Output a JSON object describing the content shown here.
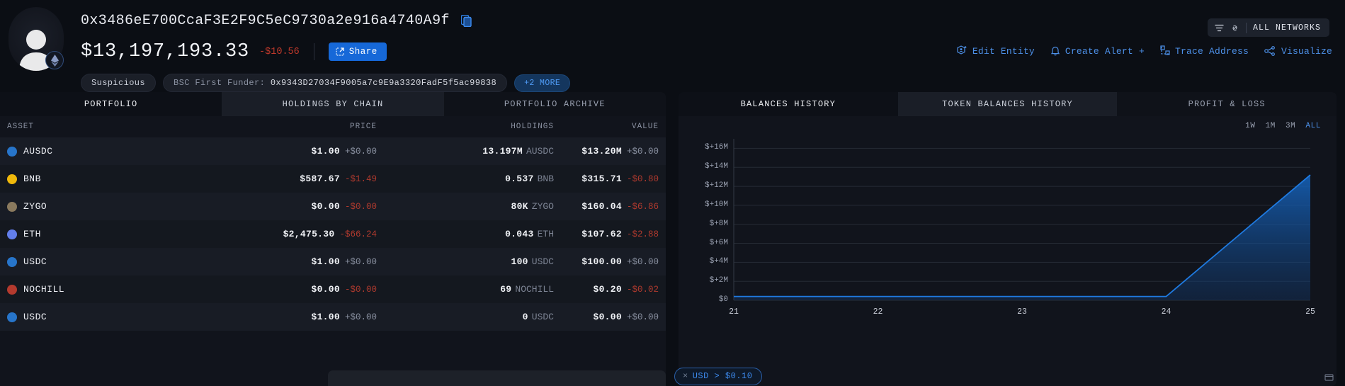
{
  "header": {
    "address": "0x3486eE700CcaF3E2F9C5eC9730a2e916a4740A9f",
    "copy_icon": "copy-icon",
    "balance": "$13,197,193.33",
    "balance_delta": "-$10.56",
    "share_label": "Share",
    "share_icon": "external-link-icon",
    "avatar_icon": "user-avatar-icon",
    "chain_icon": "ethereum-icon",
    "tags": {
      "suspicious": "Suspicious",
      "funder_label": "BSC First Funder:",
      "funder_address": "0x9343D27034F9005a7c9E9a3320FadF5f5ac99838",
      "more": "+2 MORE"
    },
    "network_pill": {
      "filter_icon": "filter-icon",
      "link_icon": "link-icon",
      "label": "ALL NETWORKS"
    },
    "actions": [
      {
        "label": "Edit Entity",
        "icon": "edit-entity-icon"
      },
      {
        "label": "Create Alert +",
        "icon": "bell-icon"
      },
      {
        "label": "Trace Address",
        "icon": "trace-icon"
      },
      {
        "label": "Visualize",
        "icon": "graph-icon"
      }
    ]
  },
  "portfolio": {
    "tabs": [
      {
        "label": "PORTFOLIO",
        "state": "active"
      },
      {
        "label": "HOLDINGS BY CHAIN",
        "state": "hover"
      },
      {
        "label": "PORTFOLIO ARCHIVE",
        "state": "normal"
      }
    ],
    "columns": [
      "ASSET",
      "PRICE",
      "HOLDINGS",
      "VALUE"
    ],
    "rows": [
      {
        "asset": "AUSDC",
        "color": "#2775ca",
        "price": "$1.00",
        "price_delta": "+$0.00",
        "price_dir": "up",
        "holdings": "13.197M",
        "holdings_unit": "AUSDC",
        "value": "$13.20M",
        "value_delta": "+$0.00",
        "value_dir": "up"
      },
      {
        "asset": "BNB",
        "color": "#f0b90b",
        "price": "$587.67",
        "price_delta": "-$1.49",
        "price_dir": "down",
        "holdings": "0.537",
        "holdings_unit": "BNB",
        "value": "$315.71",
        "value_delta": "-$0.80",
        "value_dir": "down"
      },
      {
        "asset": "ZYGO",
        "color": "#8a7a5e",
        "price": "$0.00",
        "price_delta": "-$0.00",
        "price_dir": "down",
        "holdings": "80K",
        "holdings_unit": "ZYGO",
        "value": "$160.04",
        "value_delta": "-$6.86",
        "value_dir": "down"
      },
      {
        "asset": "ETH",
        "color": "#627eea",
        "price": "$2,475.30",
        "price_delta": "-$66.24",
        "price_dir": "down",
        "holdings": "0.043",
        "holdings_unit": "ETH",
        "value": "$107.62",
        "value_delta": "-$2.88",
        "value_dir": "down"
      },
      {
        "asset": "USDC",
        "color": "#2775ca",
        "price": "$1.00",
        "price_delta": "+$0.00",
        "price_dir": "up",
        "holdings": "100",
        "holdings_unit": "USDC",
        "value": "$100.00",
        "value_delta": "+$0.00",
        "value_dir": "up"
      },
      {
        "asset": "NOCHILL",
        "color": "#b43a2e",
        "price": "$0.00",
        "price_delta": "-$0.00",
        "price_dir": "down",
        "holdings": "69",
        "holdings_unit": "NOCHILL",
        "value": "$0.20",
        "value_delta": "-$0.02",
        "value_dir": "down"
      },
      {
        "asset": "USDC",
        "color": "#2775ca",
        "price": "$1.00",
        "price_delta": "+$0.00",
        "price_dir": "up",
        "holdings": "0",
        "holdings_unit": "USDC",
        "value": "$0.00",
        "value_delta": "+$0.00",
        "value_dir": "up"
      }
    ]
  },
  "chart_panel": {
    "tabs": [
      {
        "label": "BALANCES HISTORY",
        "state": "active"
      },
      {
        "label": "TOKEN BALANCES HISTORY",
        "state": "hover"
      },
      {
        "label": "PROFIT & LOSS",
        "state": "normal"
      }
    ],
    "ranges": [
      {
        "label": "1W",
        "active": false
      },
      {
        "label": "1M",
        "active": false
      },
      {
        "label": "3M",
        "active": false
      },
      {
        "label": "ALL",
        "active": true
      }
    ],
    "filter_pill": {
      "close": "×",
      "label": "USD > $0.10"
    }
  },
  "chart_data": {
    "type": "area",
    "title": "Balances History",
    "xlabel": "",
    "ylabel": "",
    "grid": true,
    "legend": false,
    "ylim": [
      0,
      17000000
    ],
    "ytick_labels": [
      "$+16M",
      "$+14M",
      "$+12M",
      "$+10M",
      "$+8M",
      "$+6M",
      "$+4M",
      "$+2M",
      "$0"
    ],
    "ytick_values": [
      16000000,
      14000000,
      12000000,
      10000000,
      8000000,
      6000000,
      4000000,
      2000000,
      0
    ],
    "xtick_labels": [
      "21",
      "22",
      "23",
      "24",
      "25"
    ],
    "x": [
      21,
      22,
      23,
      24,
      25
    ],
    "series": [
      {
        "name": "Balance",
        "color": "#1565c0",
        "values": [
          400000,
          400000,
          400000,
          400000,
          13200000
        ]
      }
    ]
  },
  "footer": {
    "sandbox_icon": "sandbox-icon"
  }
}
